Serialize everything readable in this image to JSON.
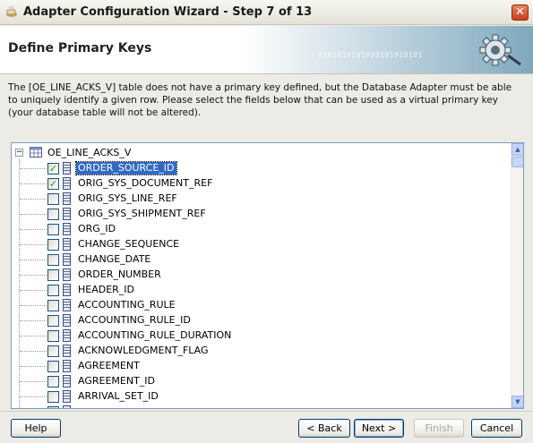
{
  "window": {
    "title": "Adapter Configuration Wizard - Step 7 of 13",
    "close_label": "✕"
  },
  "header": {
    "heading": "Define Primary Keys",
    "binary_text": "0101010101010101010101"
  },
  "description": "The [OE_LINE_ACKS_V] table does not have a primary key defined, but the Database Adapter must be able to uniquely identify a given row.  Please select the fields below that can be used as a virtual primary key (your database table will not be altered).",
  "tree": {
    "root_label": "OE_LINE_ACKS_V",
    "expander": "−",
    "fields": [
      {
        "label": "ORDER_SOURCE_ID",
        "checked": true,
        "selected": true
      },
      {
        "label": "ORIG_SYS_DOCUMENT_REF",
        "checked": true,
        "selected": false
      },
      {
        "label": "ORIG_SYS_LINE_REF",
        "checked": false,
        "selected": false
      },
      {
        "label": "ORIG_SYS_SHIPMENT_REF",
        "checked": false,
        "selected": false
      },
      {
        "label": "ORG_ID",
        "checked": false,
        "selected": false
      },
      {
        "label": "CHANGE_SEQUENCE",
        "checked": false,
        "selected": false
      },
      {
        "label": "CHANGE_DATE",
        "checked": false,
        "selected": false
      },
      {
        "label": "ORDER_NUMBER",
        "checked": false,
        "selected": false
      },
      {
        "label": "HEADER_ID",
        "checked": false,
        "selected": false
      },
      {
        "label": "ACCOUNTING_RULE",
        "checked": false,
        "selected": false
      },
      {
        "label": "ACCOUNTING_RULE_ID",
        "checked": false,
        "selected": false
      },
      {
        "label": "ACCOUNTING_RULE_DURATION",
        "checked": false,
        "selected": false
      },
      {
        "label": "ACKNOWLEDGMENT_FLAG",
        "checked": false,
        "selected": false
      },
      {
        "label": "AGREEMENT",
        "checked": false,
        "selected": false
      },
      {
        "label": "AGREEMENT_ID",
        "checked": false,
        "selected": false
      },
      {
        "label": "ARRIVAL_SET_ID",
        "checked": false,
        "selected": false
      },
      {
        "label": "",
        "checked": false,
        "selected": false
      }
    ]
  },
  "buttons": {
    "help": "Help",
    "back": "< Back",
    "next": "Next >",
    "finish": "Finish",
    "cancel": "Cancel"
  },
  "colors": {
    "selection": "#316ac5",
    "check": "#21a121",
    "close": "#c7401e"
  }
}
